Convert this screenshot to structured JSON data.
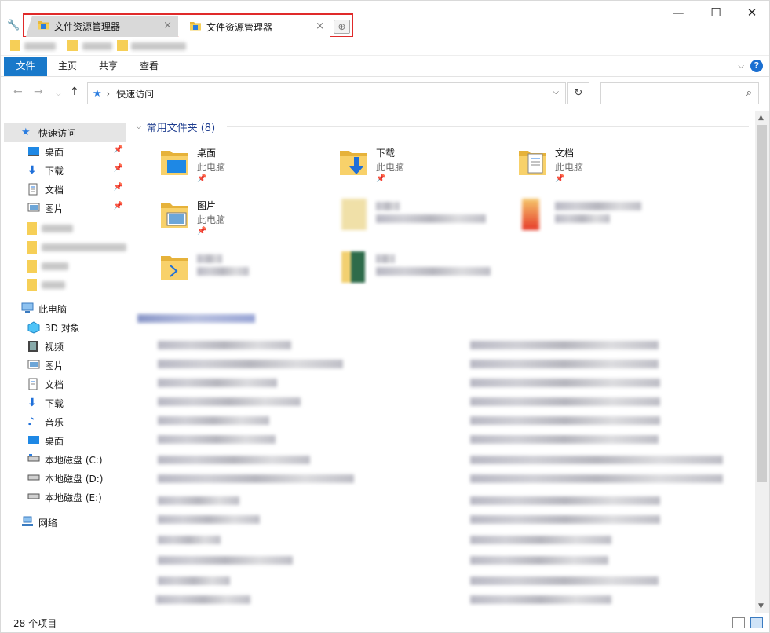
{
  "window": {
    "tabs": [
      {
        "label": "文件资源管理器",
        "active": false
      },
      {
        "label": "文件资源管理器",
        "active": true
      }
    ],
    "new_tab_icon": "plus-icon",
    "controls": {
      "minimize": "—",
      "maximize": "☐",
      "close": "✕"
    }
  },
  "ribbon": {
    "tabs": [
      "文件",
      "主页",
      "共享",
      "查看"
    ],
    "help": "?"
  },
  "address": {
    "path": "快速访问",
    "search_placeholder": ""
  },
  "nav": {
    "quick_access": "快速访问",
    "quick_items": [
      "桌面",
      "下载",
      "文档",
      "图片"
    ],
    "this_pc": "此电脑",
    "pc_items": [
      "3D 对象",
      "视频",
      "图片",
      "文档",
      "下载",
      "音乐",
      "桌面",
      "本地磁盘 (C:)",
      "本地磁盘 (D:)",
      "本地磁盘 (E:)"
    ],
    "network": "网络"
  },
  "main": {
    "group_title": "常用文件夹 (8)",
    "tiles": [
      {
        "name": "桌面",
        "sub": "此电脑"
      },
      {
        "name": "下载",
        "sub": "此电脑"
      },
      {
        "name": "文档",
        "sub": "此电脑"
      },
      {
        "name": "图片",
        "sub": "此电脑"
      }
    ]
  },
  "status": {
    "count": "28 个项目"
  },
  "colors": {
    "accent": "#1979ca",
    "selection": "#e5e5e5",
    "tab_outline": "#e02a2a",
    "group_title": "#1e3d8f"
  }
}
